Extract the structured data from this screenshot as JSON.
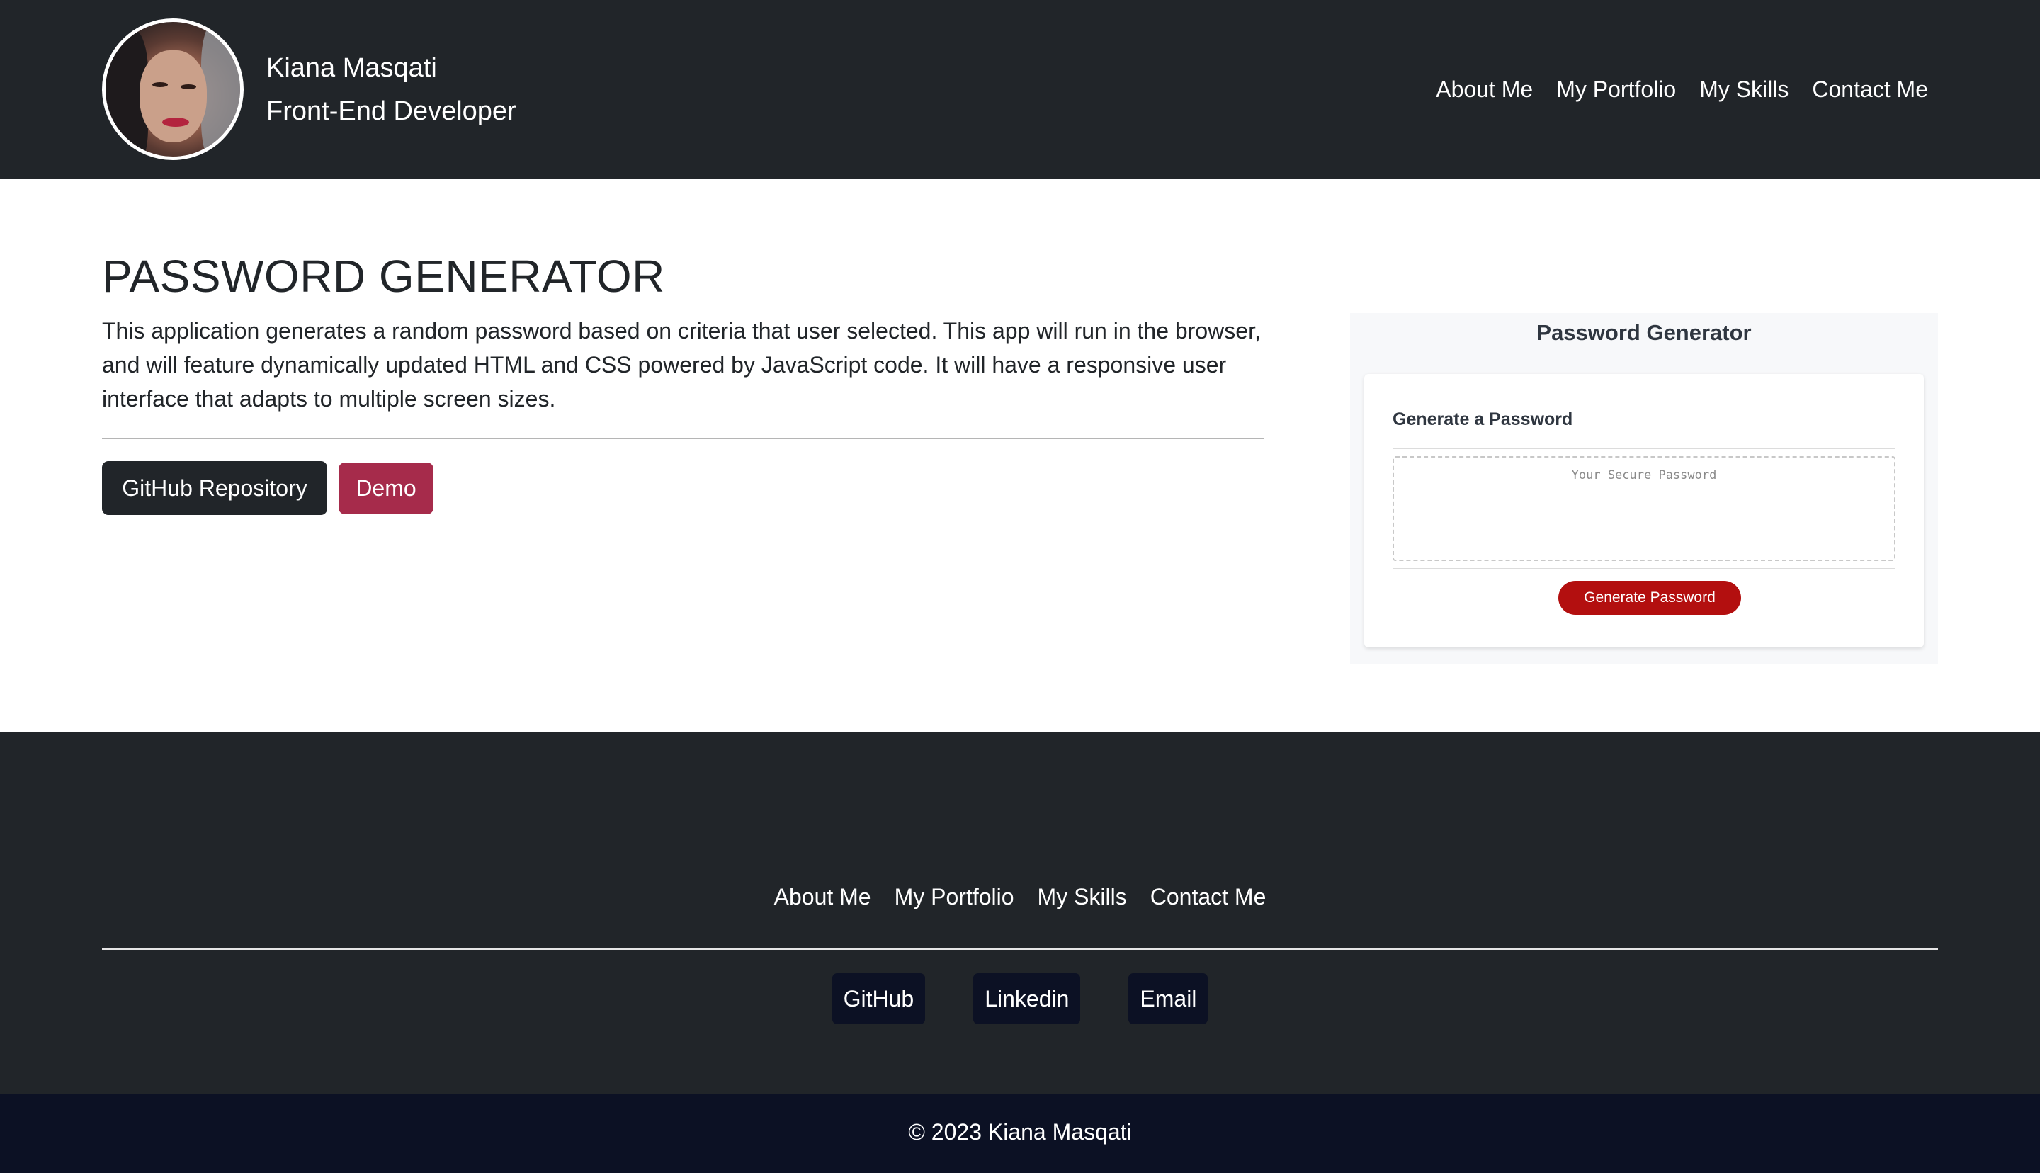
{
  "header": {
    "name": "Kiana Masqati",
    "role": "Front-End Developer",
    "nav": [
      "About Me",
      "My Portfolio",
      "My Skills",
      "Contact Me"
    ]
  },
  "main": {
    "title": "PASSWORD GENERATOR",
    "description": "This application generates a random password based on criteria that user selected. This app will run in the browser, and will feature dynamically updated HTML and CSS powered by JavaScript code. It will have a responsive user interface that adapts to multiple screen sizes.",
    "buttons": {
      "github": "GitHub Repository",
      "demo": "Demo"
    }
  },
  "preview": {
    "title": "Password Generator",
    "card_heading": "Generate a Password",
    "placeholder": "Your Secure Password",
    "button": "Generate Password"
  },
  "footer": {
    "nav": [
      "About Me",
      "My Portfolio",
      "My Skills",
      "Contact Me"
    ],
    "social": [
      "GitHub",
      "Linkedin",
      "Email"
    ],
    "copyright": "© 2023 Kiana Masqati"
  },
  "colors": {
    "dark": "#212529",
    "navy": "#0c1124",
    "demo_accent": "#a62b4b",
    "generate_button": "#b30f0f"
  }
}
